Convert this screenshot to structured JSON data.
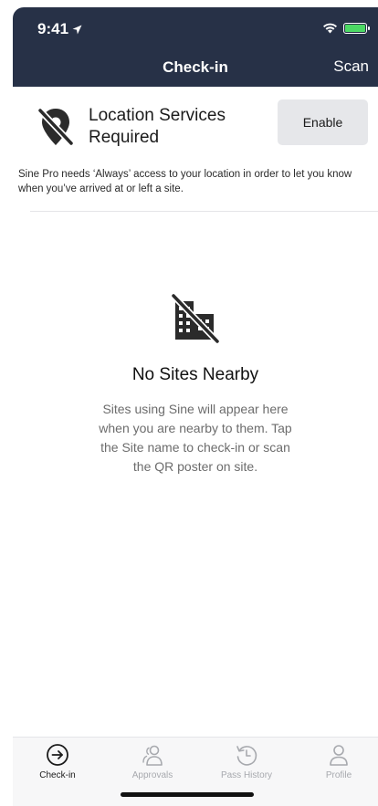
{
  "status_bar": {
    "time": "9:41",
    "location_icon": "location-arrow-icon",
    "wifi_icon": "wifi-icon",
    "battery_icon": "battery-charging-icon"
  },
  "nav": {
    "title": "Check-in",
    "scan_label": "Scan"
  },
  "location_banner": {
    "icon": "location-off-icon",
    "title": "Location Services Required",
    "enable_label": "Enable",
    "description": "Sine Pro needs ‘Always’ access to your location in order to let you know when you’ve arrived at or left a site."
  },
  "empty_state": {
    "icon": "no-buildings-icon",
    "title": "No Sites Nearby",
    "description": "Sites using Sine will appear here when you are nearby to them. Tap the Site name to check-in or scan the QR poster on site."
  },
  "tabs": [
    {
      "label": "Check-in",
      "icon": "arrow-circle-icon",
      "active": true
    },
    {
      "label": "Approvals",
      "icon": "people-icon",
      "active": false
    },
    {
      "label": "Pass History",
      "icon": "history-icon",
      "active": false
    },
    {
      "label": "Profile",
      "icon": "person-icon",
      "active": false
    }
  ],
  "colors": {
    "header_bg": "#273147",
    "battery_green": "#4cd964",
    "button_bg": "#e6e7ea",
    "inactive_tab": "#a7a9ae"
  }
}
